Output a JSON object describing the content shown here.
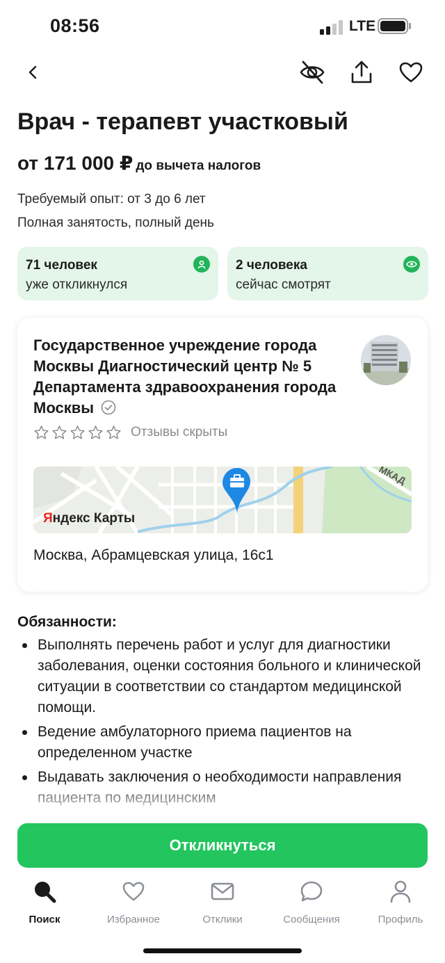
{
  "status_bar": {
    "time": "08:56",
    "network": "LTE",
    "signal_bars_active": 2,
    "signal_bars_total": 4,
    "battery_level": 0.9
  },
  "nav": {
    "back_icon": "chevron-left-icon",
    "actions": [
      "hide-eye-slash-icon",
      "share-icon",
      "heart-icon"
    ]
  },
  "vacancy": {
    "title": "Врач - терапевт участковый",
    "salary": "от 171 000 ₽",
    "salary_note": "до вычета налогов",
    "experience": "Требуемый опыт: от 3 до 6 лет",
    "employment": "Полная занятость, полный день"
  },
  "stats": [
    {
      "count": "71 человек",
      "label": "уже откликнулся",
      "icon": "person-icon"
    },
    {
      "count": "2 человека",
      "label": "сейчас смотрят",
      "icon": "eye-icon"
    }
  ],
  "employer": {
    "name": "Государственное учреждение города Москвы Диагностический центр № 5 Департамента здравоохранения города Москвы",
    "verified_icon": "check-circle-icon",
    "rating_stars": 0,
    "reviews_text": "Отзывы скрыты",
    "map_logo_y": "Я",
    "map_logo_rest": "ндекс Карты",
    "map_label": "МКАД",
    "address": "Москва, Абрамцевская улица, 16с1"
  },
  "duties": {
    "title": "Обязанности:",
    "items": [
      "Выполнять перечень работ и услуг для диагностики заболевания, оценки состояния больного и клинической ситуации в соответствии со стандартом медицинской помощи.",
      "Ведение амбулаторного приема пациентов на определенном участке",
      "Выдавать заключения о необходимости направления пациента по медицинским"
    ]
  },
  "apply_button": "Откликнуться",
  "tabbar": [
    {
      "label": "Поиск",
      "icon": "search-icon",
      "active": true
    },
    {
      "label": "Избранное",
      "icon": "heart-icon",
      "active": false
    },
    {
      "label": "Отклики",
      "icon": "envelope-icon",
      "active": false
    },
    {
      "label": "Сообщения",
      "icon": "chat-bubble-icon",
      "active": false
    },
    {
      "label": "Профиль",
      "icon": "person-icon",
      "active": false
    }
  ],
  "colors": {
    "accent_green": "#22c55e",
    "stat_card_bg": "#e3f6e9",
    "badge_green": "#22b45a",
    "map_pin_blue": "#1e88e5"
  }
}
